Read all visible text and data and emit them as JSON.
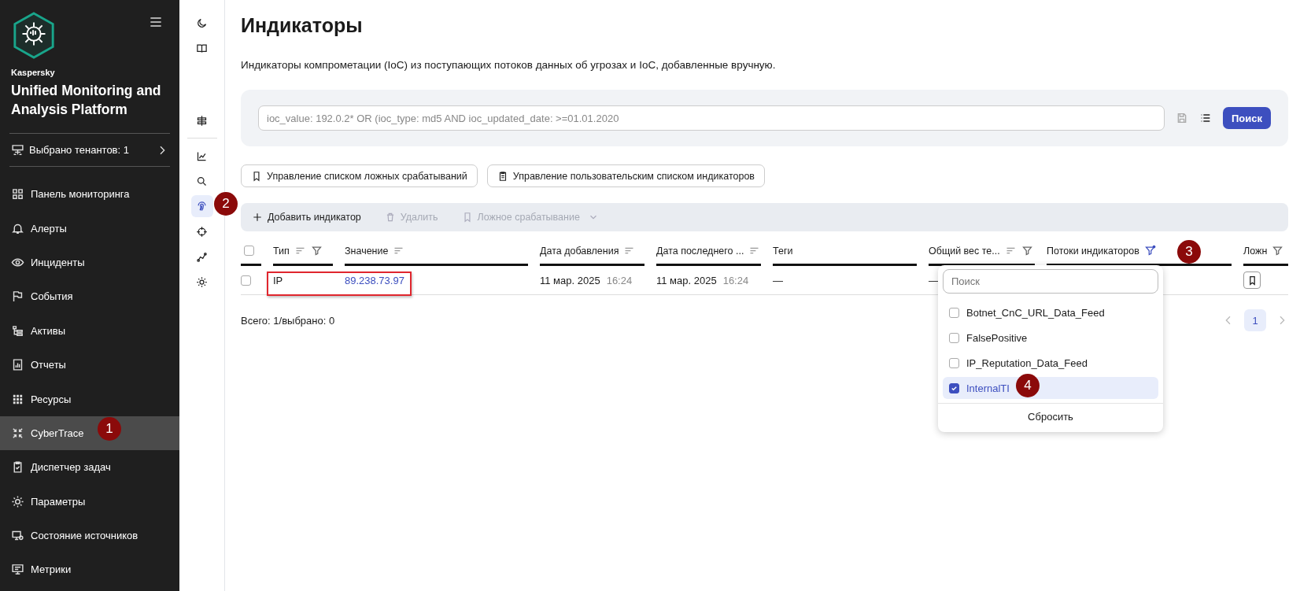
{
  "sidebar": {
    "brand": "Kaspersky",
    "product": "Unified Monitoring and Analysis Platform",
    "tenants": "Выбрано тенантов: 1",
    "items": [
      {
        "label": "Панель мониторинга",
        "selected": false
      },
      {
        "label": "Алерты",
        "selected": false
      },
      {
        "label": "Инциденты",
        "selected": false
      },
      {
        "label": "События",
        "selected": false
      },
      {
        "label": "Активы",
        "selected": false
      },
      {
        "label": "Отчеты",
        "selected": false
      },
      {
        "label": "Ресурсы",
        "selected": false
      },
      {
        "label": "CyberTrace",
        "selected": true
      },
      {
        "label": "Диспетчер задач",
        "selected": false
      },
      {
        "label": "Параметры",
        "selected": false
      },
      {
        "label": "Состояние источников",
        "selected": false
      },
      {
        "label": "Метрики",
        "selected": false
      }
    ]
  },
  "rail_groups": [
    [
      {
        "selected": false
      },
      {
        "selected": false
      }
    ],
    [
      {
        "selected": false
      }
    ],
    [
      {
        "selected": false
      },
      {
        "selected": false
      },
      {
        "selected": true
      },
      {
        "selected": false
      },
      {
        "selected": false
      },
      {
        "selected": false
      }
    ]
  ],
  "page": {
    "title": "Индикаторы",
    "description": "Индикаторы компрометации (IoC) из поступающих потоков данных об угрозах и IoC, добавленные вручную.",
    "query": {
      "placeholder": "ioc_value: 192.0.2* OR (ioc_type: md5 AND ioc_updated_date: >=01.01.2020"
    },
    "search_button": "Поиск",
    "list_buttons": [
      "Управление списком ложных срабатываний",
      "Управление пользовательским списком индикаторов"
    ],
    "toolbar": [
      {
        "label": "Добавить индикатор",
        "disabled": false,
        "menu": false
      },
      {
        "label": "Удалить",
        "disabled": true,
        "menu": false
      },
      {
        "label": "Ложное срабатывание",
        "disabled": true,
        "menu": true
      }
    ]
  },
  "table": {
    "select_all": {
      "checked": false
    },
    "columns": [
      {
        "label": "Тип",
        "sort": true,
        "filter": true,
        "filter_active": false
      },
      {
        "label": "Значение",
        "sort": true,
        "filter": false
      },
      {
        "label": "Дата добавления",
        "sort": true,
        "filter": false
      },
      {
        "label": "Дата последнего ...",
        "sort": true,
        "filter": false
      },
      {
        "label": "Теги",
        "sort": false,
        "filter": false
      },
      {
        "label": "Общий вес те...",
        "sort": true,
        "filter": true,
        "filter_active": false
      },
      {
        "label": "Потоки индикаторов",
        "sort": false,
        "filter": true,
        "filter_active": true
      },
      {
        "label": "Ложн",
        "sort": false,
        "filter": true,
        "filter_active": false
      }
    ],
    "rows": [
      {
        "checked": false,
        "type": "IP",
        "value": "89.238.73.97",
        "added_date": "11 мар. 2025",
        "added_time": "16:24",
        "updated_date": "11 мар. 2025",
        "updated_time": "16:24",
        "tags": "—",
        "weight": "—"
      }
    ]
  },
  "footer": "Всего: 1/выбрано: 0",
  "pages": [
    {
      "label": "1",
      "selected": true
    }
  ],
  "filter_menu": {
    "placeholder": "Поиск",
    "options": [
      {
        "label": "Botnet_CnC_URL_Data_Feed",
        "checked": false,
        "selected": false
      },
      {
        "label": "FalsePositive",
        "checked": false,
        "selected": false
      },
      {
        "label": "IP_Reputation_Data_Feed",
        "checked": false,
        "selected": false
      },
      {
        "label": "InternalTI",
        "checked": true,
        "selected": true
      }
    ],
    "reset": "Сбросить"
  },
  "callouts": [
    {
      "label": "1"
    },
    {
      "label": "2"
    },
    {
      "label": "3"
    },
    {
      "label": "4"
    }
  ]
}
